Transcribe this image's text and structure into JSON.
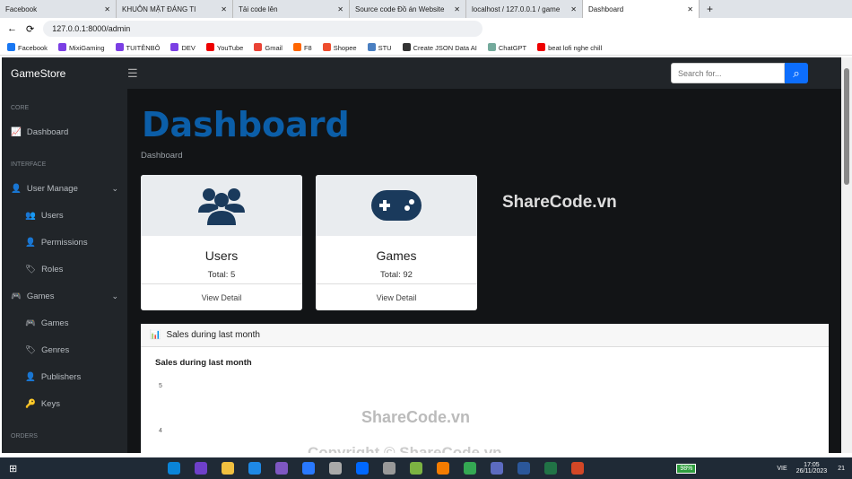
{
  "browser": {
    "tabs": [
      "Facebook",
      "KHUÔN MẶT ĐÁNG TI",
      "Tải code lên",
      "Source code Đồ án Website",
      "localhost / 127.0.0.1 / game",
      "Dashboard"
    ],
    "url": "127.0.0.1:8000/admin",
    "bookmarks": [
      "Facebook",
      "MixiGaming",
      "TUITÊNBÔ",
      "DEV",
      "YouTube",
      "Gmail",
      "F8",
      "Shopee",
      "STU",
      "Create JSON Data AI",
      "ChatGPT",
      "beat lofi nghe chill"
    ]
  },
  "app": {
    "brand": "GameStore",
    "search_placeholder": "Search for...",
    "sidebar": {
      "core": "CORE",
      "dashboard": "Dashboard",
      "interface": "INTERFACE",
      "user_manage": "User Manage",
      "users": "Users",
      "permissions": "Permissions",
      "roles": "Roles",
      "games_group": "Games",
      "games": "Games",
      "genres": "Genres",
      "publishers": "Publishers",
      "keys": "Keys",
      "orders": "ORDERS"
    },
    "title": "Dashboard",
    "breadcrumb": "Dashboard",
    "cards": [
      {
        "title": "Users",
        "total": "Total: 5",
        "link": "View Detail",
        "icon": "users-icon"
      },
      {
        "title": "Games",
        "total": "Total: 92",
        "link": "View Detail",
        "icon": "gamepad-icon"
      }
    ],
    "chart": {
      "header": "Sales during last month",
      "title": "Sales during last month",
      "yticks": [
        "5",
        "4"
      ]
    },
    "watermark": "ShareCode.vn",
    "copyright": "Copyright © ShareCode.vn"
  },
  "taskbar": {
    "battery": "98%",
    "lang": "VIE",
    "time": "17:05",
    "date": "26/11/2023",
    "notifications": "21"
  },
  "colors": {
    "accent": "#0d6efd",
    "title": "#0b5ea8",
    "sidebar": "#212529"
  }
}
